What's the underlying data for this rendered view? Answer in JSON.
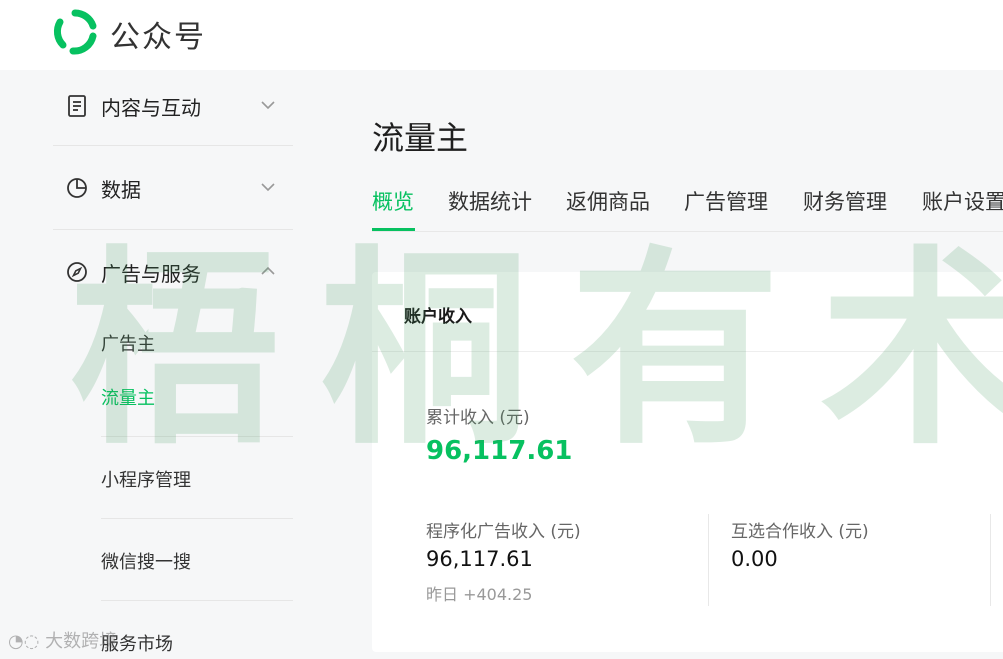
{
  "app": {
    "title": "公众号"
  },
  "sidebar": {
    "groups": [
      {
        "label": "内容与互动",
        "icon": "document-icon"
      },
      {
        "label": "数据",
        "icon": "pie-chart-icon"
      },
      {
        "label": "广告与服务",
        "icon": "compass-icon"
      }
    ],
    "sub_items": [
      {
        "label": "广告主"
      },
      {
        "label": "流量主"
      },
      {
        "label": "小程序管理"
      },
      {
        "label": "微信搜一搜"
      },
      {
        "label": "服务市场"
      }
    ]
  },
  "main": {
    "title": "流量主",
    "tabs": [
      {
        "label": "概览"
      },
      {
        "label": "数据统计"
      },
      {
        "label": "返佣商品"
      },
      {
        "label": "广告管理"
      },
      {
        "label": "财务管理"
      },
      {
        "label": "账户设置"
      }
    ]
  },
  "account_income": {
    "title": "账户收入",
    "total_label": "累计收入 (元)",
    "total_value": "96,117.61",
    "programmatic_label": "程序化广告收入 (元)",
    "programmatic_value": "96,117.61",
    "yesterday_text": "昨日 +404.25",
    "mutual_label": "互选合作收入 (元)",
    "mutual_value": "0.00"
  },
  "watermark": {
    "text": "梧桐有术",
    "corner_text": "大数跨境"
  },
  "colors": {
    "accent": "#07c160",
    "watermark": "#3c965a"
  }
}
